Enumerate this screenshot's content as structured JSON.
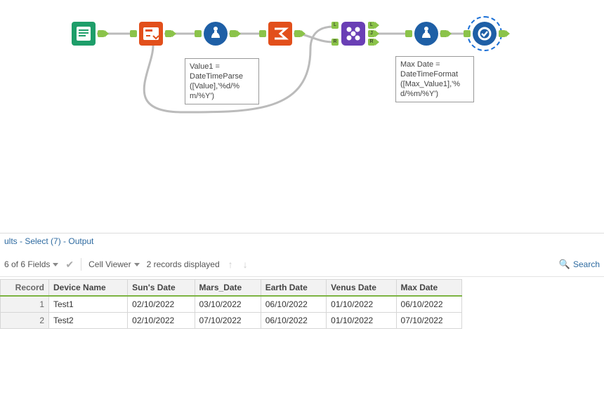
{
  "workflow": {
    "tools": {
      "text_input": {
        "name": "text-input-tool"
      },
      "select": {
        "name": "select-tool"
      },
      "formula1": {
        "name": "formula-tool-1",
        "annotation": "Value1 =\nDateTimeParse\n([Value],'%d/%\nm/%Y')"
      },
      "summarize": {
        "name": "summarize-tool"
      },
      "join": {
        "name": "join-tool",
        "ports_left": [
          "L",
          "R"
        ],
        "ports_right": [
          "L",
          "J",
          "R"
        ]
      },
      "formula2": {
        "name": "formula-tool-2",
        "annotation": "Max Date =\nDateTimeFormat\n([Max_Value1],'%\nd/%m/%Y')"
      },
      "browse": {
        "name": "browse-tool",
        "selected": true
      }
    }
  },
  "results": {
    "header_text": "ults - Select (7) - Output",
    "toolbar": {
      "fields_label": "6 of 6 Fields",
      "cell_viewer_label": "Cell Viewer",
      "records_text": "2 records displayed",
      "search_label": "Search"
    },
    "columns": [
      "Record",
      "Device Name",
      "Sun's Date",
      "Mars_Date",
      "Earth Date",
      "Venus Date",
      "Max Date"
    ],
    "rows": [
      {
        "record": "1",
        "cells": [
          "Test1",
          "02/10/2022",
          "03/10/2022",
          "06/10/2022",
          "01/10/2022",
          "06/10/2022"
        ]
      },
      {
        "record": "2",
        "cells": [
          "Test2",
          "02/10/2022",
          "07/10/2022",
          "06/10/2022",
          "01/10/2022",
          "07/10/2022"
        ]
      }
    ]
  }
}
